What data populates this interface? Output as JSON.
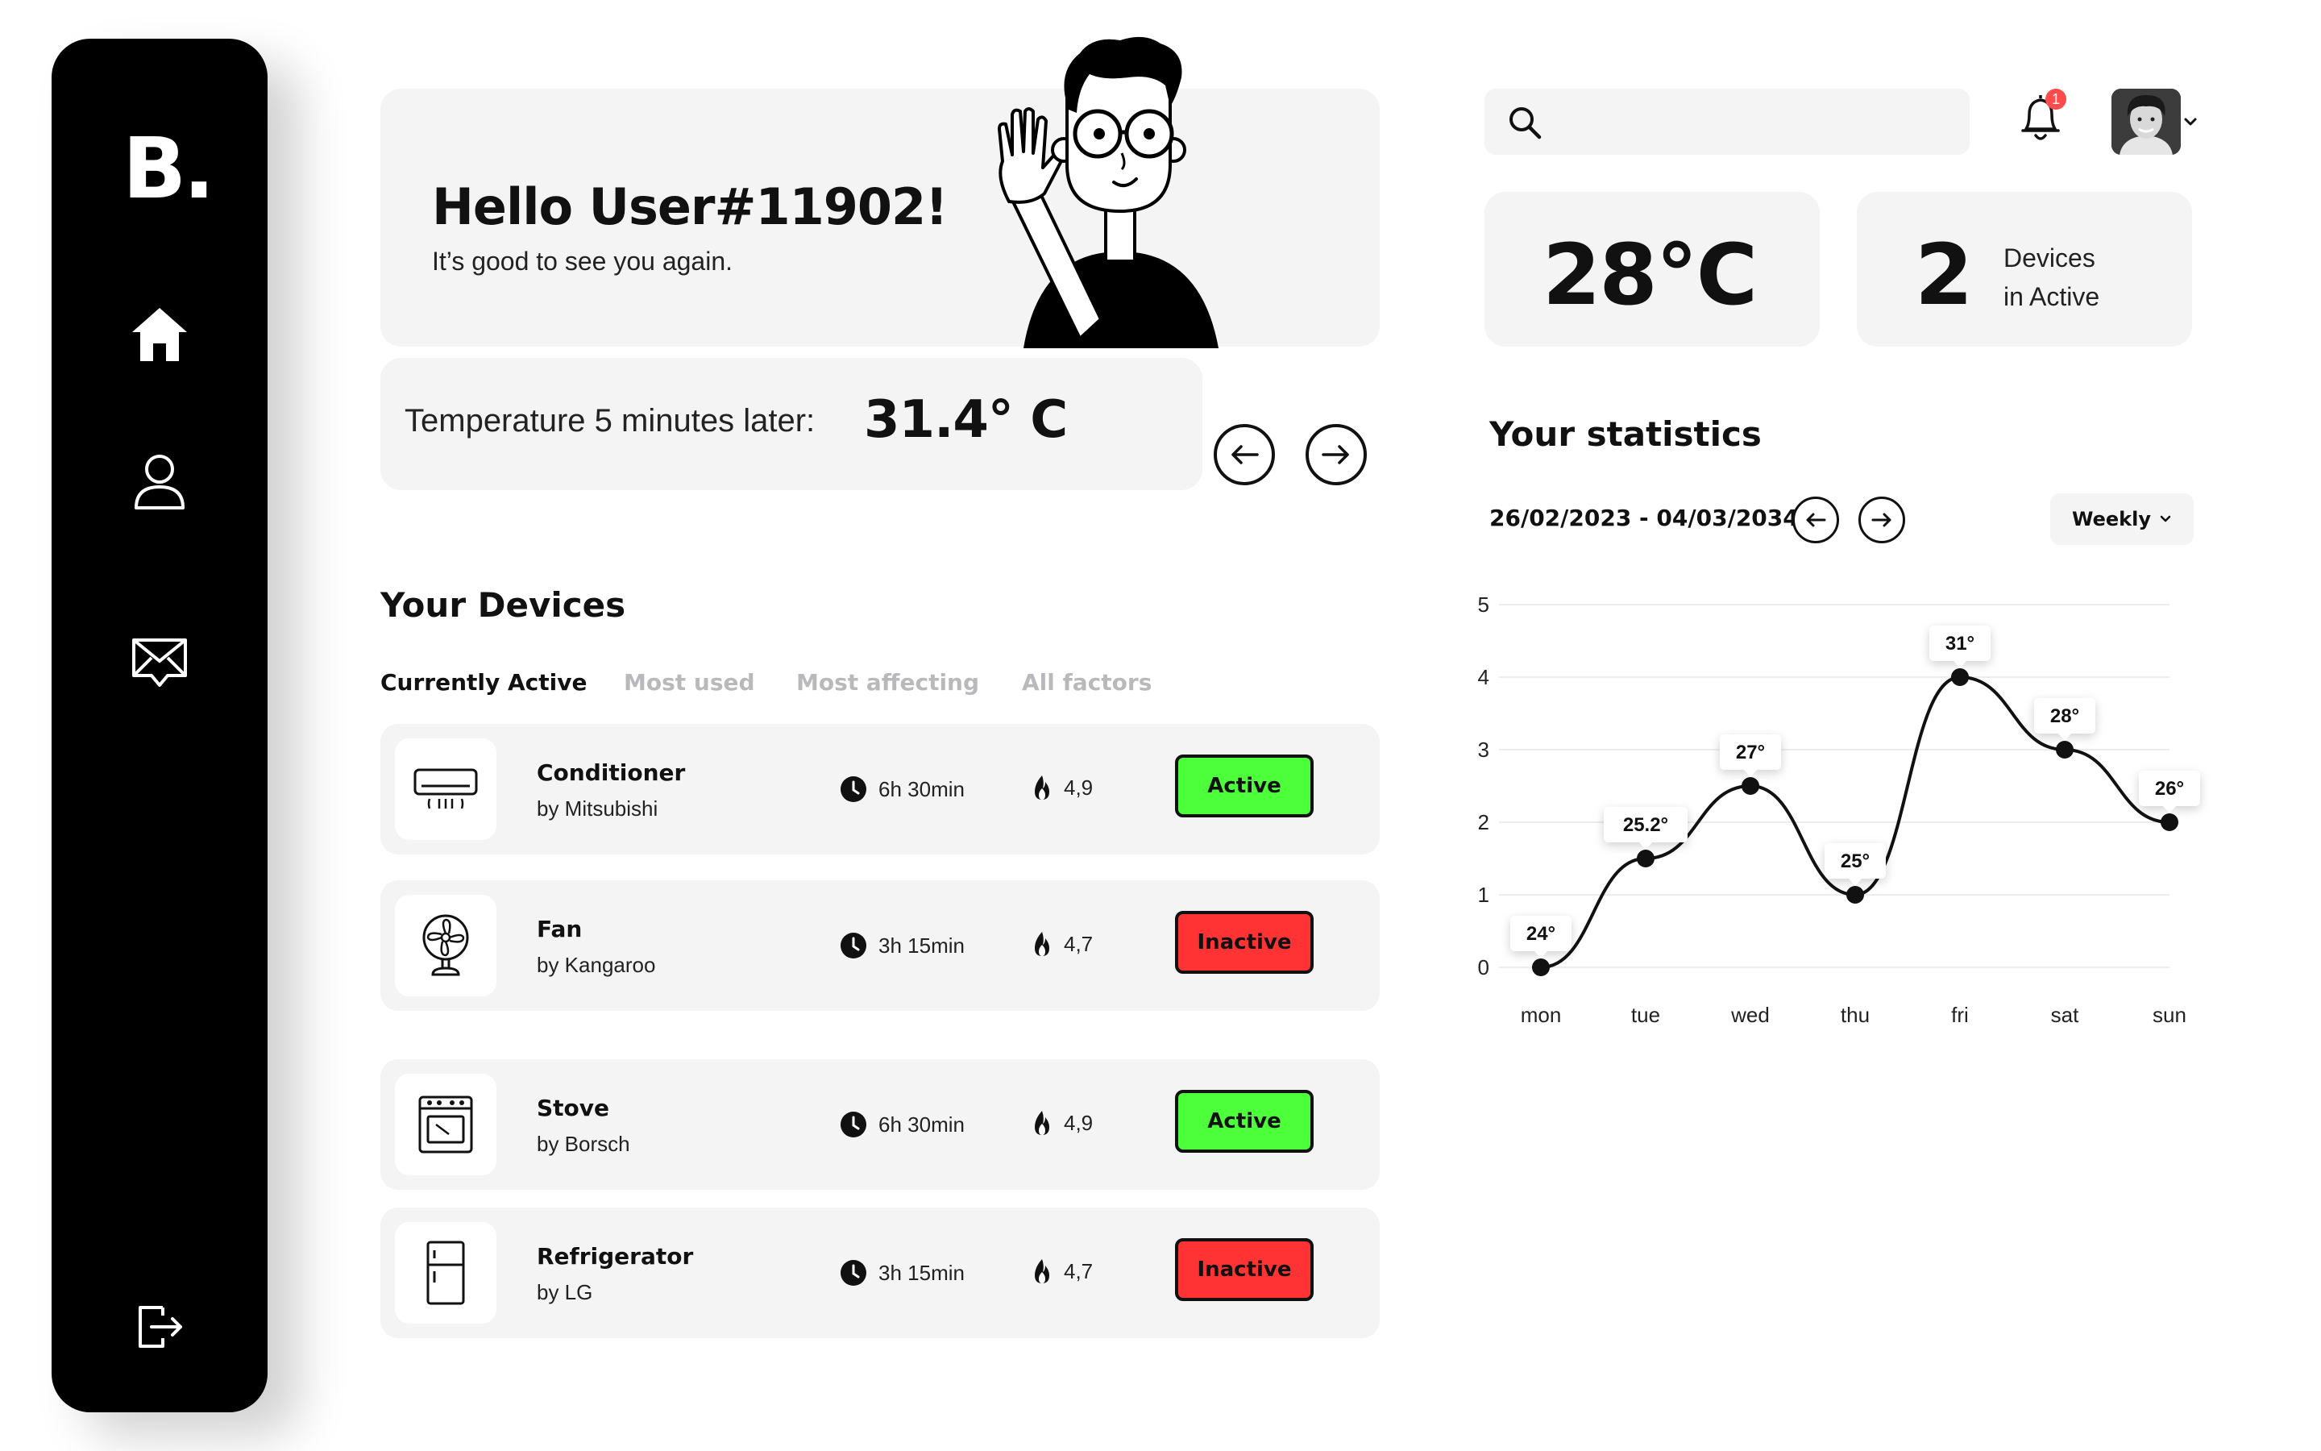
{
  "brand": {
    "logo": "B."
  },
  "greeting": {
    "title": "Hello User#11902!",
    "subtitle": "It’s good to see you again."
  },
  "forecast": {
    "label": "Temperature 5 minutes later:",
    "value": "31.4° C"
  },
  "devices_section": {
    "title": "Your Devices",
    "tabs": [
      "Currently Active",
      "Most used",
      "Most affecting",
      "All factors"
    ],
    "active_tab": "Currently Active"
  },
  "devices": [
    {
      "name": "Conditioner",
      "brand": "by Mitsubishi",
      "time": "6h 30min",
      "rating": "4,9",
      "status": "Active",
      "status_color": "#4cff3a",
      "icon": "air-conditioner-icon"
    },
    {
      "name": "Fan",
      "brand": "by Kangaroo",
      "time": "3h 15min",
      "rating": "4,7",
      "status": "Inactive",
      "status_color": "#ff3333",
      "icon": "fan-icon"
    },
    {
      "name": "Stove",
      "brand": "by Borsch",
      "time": "6h 30min",
      "rating": "4,9",
      "status": "Active",
      "status_color": "#4cff3a",
      "icon": "stove-icon"
    },
    {
      "name": "Refrigerator",
      "brand": "by LG",
      "time": "3h 15min",
      "rating": "4,7",
      "status": "Inactive",
      "status_color": "#ff3333",
      "icon": "refrigerator-icon"
    }
  ],
  "search": {
    "placeholder": ""
  },
  "notifications": {
    "count": "1"
  },
  "stats_cards": {
    "temperature": "28°C",
    "devices_count": "2",
    "devices_label_line1": "Devices",
    "devices_label_line2": "in Active"
  },
  "statistics": {
    "title": "Your statistics",
    "date_range": "26/02/2023 - 04/03/2034",
    "period": "Weekly"
  },
  "chart_data": {
    "type": "line",
    "categories": [
      "mon",
      "tue",
      "wed",
      "thu",
      "fri",
      "sat",
      "sun"
    ],
    "values": [
      0,
      1.5,
      2.5,
      1,
      4,
      3,
      2
    ],
    "data_labels": [
      "24°",
      "25.2°",
      "27°",
      "25°",
      "31°",
      "28°",
      "26°"
    ],
    "yticks": [
      "0",
      "1",
      "2",
      "3",
      "4",
      "5"
    ],
    "ylim": [
      0,
      5
    ],
    "grid": true,
    "title": "",
    "xlabel": "",
    "ylabel": ""
  }
}
